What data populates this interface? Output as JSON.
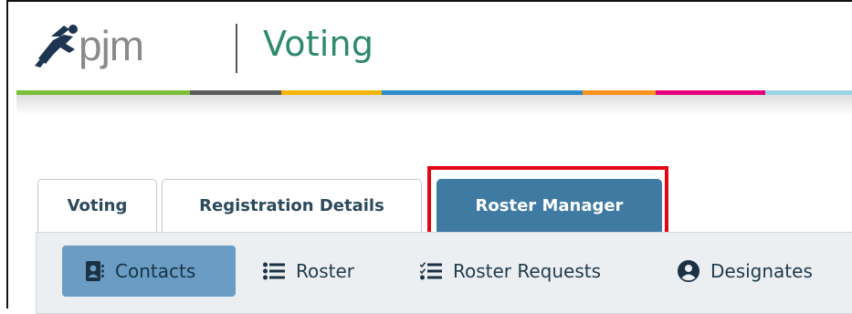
{
  "header": {
    "brand": "pjm",
    "title": "Voting",
    "stripe_colors": [
      "#7bbf3a",
      "#5c5c5c",
      "#f4b400",
      "#2e8bc9",
      "#f7941d",
      "#e6007e",
      "#9bd3e3"
    ]
  },
  "tabs": [
    {
      "label": "Voting",
      "active": false
    },
    {
      "label": "Registration Details",
      "active": false
    },
    {
      "label": "Roster Manager",
      "active": true
    }
  ],
  "subnav": [
    {
      "label": "Contacts",
      "icon": "contact-card-icon",
      "active": true
    },
    {
      "label": "Roster",
      "icon": "list-icon",
      "active": false
    },
    {
      "label": "Roster Requests",
      "icon": "checklist-icon",
      "active": false
    },
    {
      "label": "Designates",
      "icon": "user-circle-icon",
      "active": false
    }
  ],
  "colors": {
    "accent": "#3f7aa3",
    "highlight": "#e30613",
    "title": "#2e8a6f"
  }
}
